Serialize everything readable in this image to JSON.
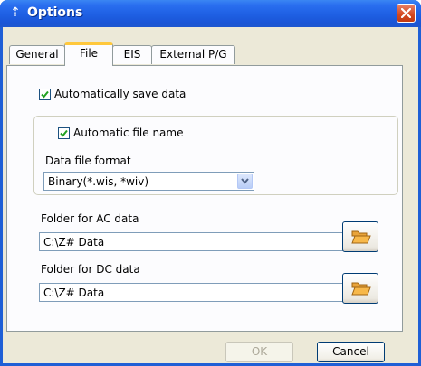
{
  "window": {
    "title": "Options",
    "app_icon": "arrow-icon",
    "close_icon": "close-icon"
  },
  "tabs": [
    {
      "label": "General",
      "active": false
    },
    {
      "label": "File",
      "active": true
    },
    {
      "label": "EIS",
      "active": false
    },
    {
      "label": "External P/G",
      "active": false
    }
  ],
  "file_tab": {
    "auto_save": {
      "label": "Automatically save data",
      "checked": true
    },
    "auto_file_name": {
      "label": "Automatic file name",
      "checked": true
    },
    "format": {
      "label": "Data file format",
      "selected": "Binary(*.wis, *wiv)"
    },
    "ac_folder": {
      "label": "Folder for AC data",
      "value": "C:\\Z# Data",
      "button_icon": "folder-open-icon"
    },
    "dc_folder": {
      "label": "Folder for DC data",
      "value": "C:\\Z# Data",
      "button_icon": "folder-open-icon"
    }
  },
  "buttons": {
    "ok": "OK",
    "cancel": "Cancel",
    "ok_enabled": false
  },
  "colors": {
    "titlebar": "#1e5fe3",
    "dialog_bg": "#ece9d8",
    "close_red": "#d4471f",
    "tab_highlight": "#ffc83c"
  }
}
